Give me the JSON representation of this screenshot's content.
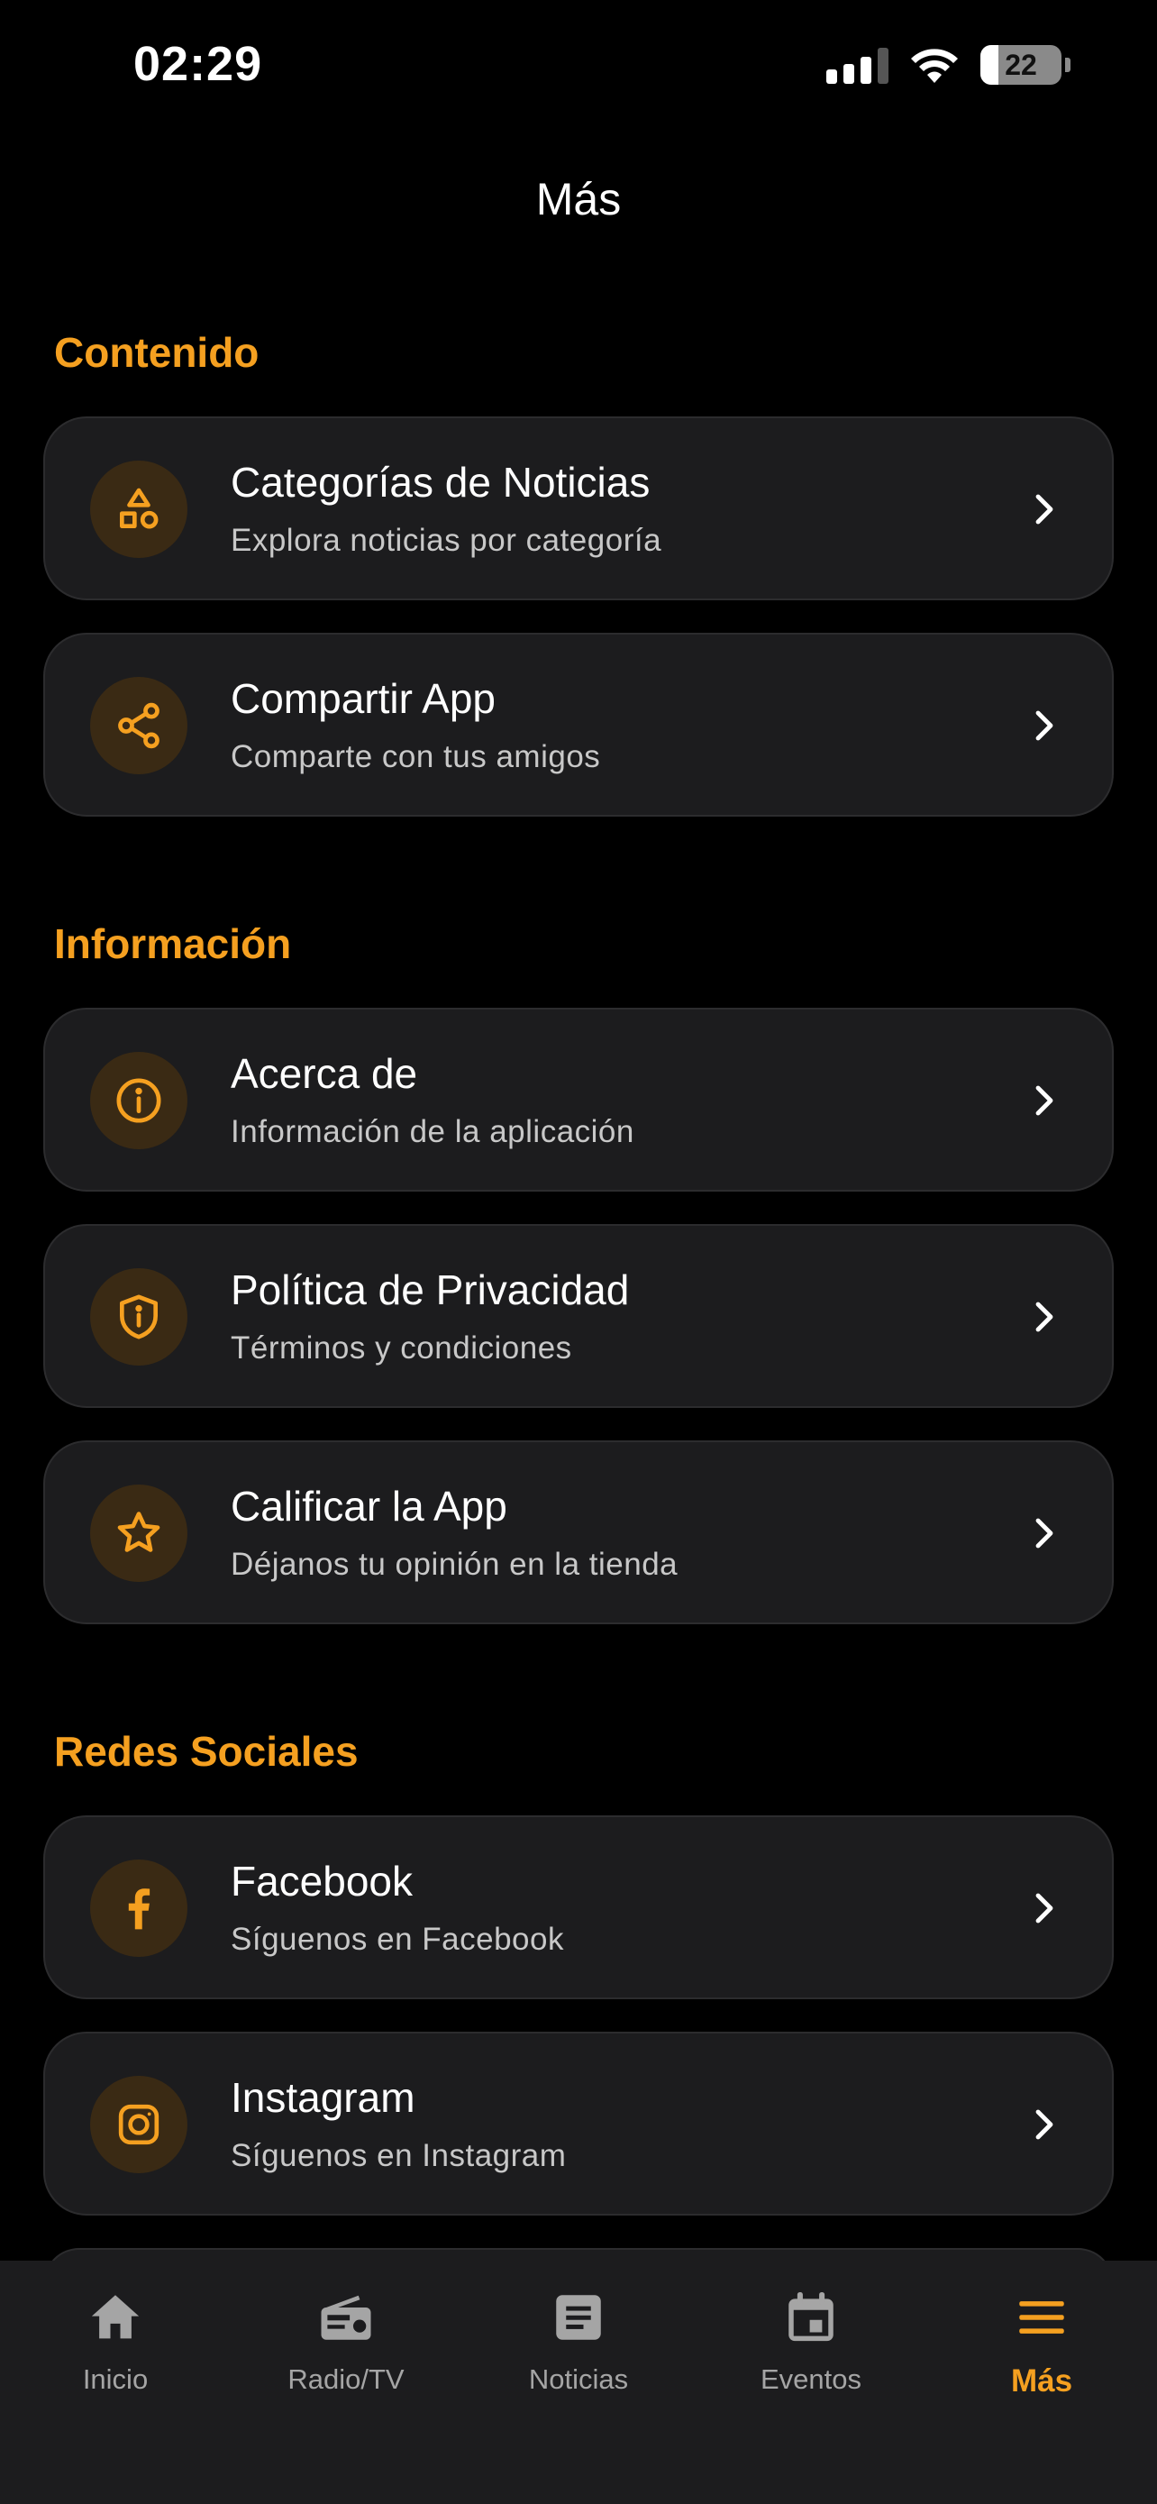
{
  "status_bar": {
    "time": "02:29",
    "battery": "22",
    "battery_level": 0.22
  },
  "header": {
    "title": "Más"
  },
  "colors": {
    "accent": "#f5a020",
    "background": "#000000",
    "card": "#1c1c1e",
    "icon_bg": "#3a2a14",
    "inactive_tab": "#a5a5a5"
  },
  "sections": [
    {
      "title": "Contenido",
      "items": [
        {
          "icon": "shapes-icon",
          "title": "Categorías de Noticias",
          "subtitle": "Explora noticias por categoría"
        },
        {
          "icon": "share-icon",
          "title": "Compartir App",
          "subtitle": "Comparte con tus amigos"
        }
      ]
    },
    {
      "title": "Información",
      "items": [
        {
          "icon": "info-icon",
          "title": "Acerca de",
          "subtitle": "Información de la aplicación"
        },
        {
          "icon": "shield-icon",
          "title": "Política de Privacidad",
          "subtitle": "Términos y condiciones"
        },
        {
          "icon": "star-icon",
          "title": "Calificar la App",
          "subtitle": "Déjanos tu opinión en la tienda"
        }
      ]
    },
    {
      "title": "Redes Sociales",
      "items": [
        {
          "icon": "facebook-icon",
          "title": "Facebook",
          "subtitle": "Síguenos en Facebook"
        },
        {
          "icon": "instagram-icon",
          "title": "Instagram",
          "subtitle": "Síguenos en Instagram"
        }
      ]
    }
  ],
  "tabs": [
    {
      "icon": "home-icon",
      "label": "Inicio"
    },
    {
      "icon": "radio-icon",
      "label": "Radio/TV"
    },
    {
      "icon": "news-icon",
      "label": "Noticias"
    },
    {
      "icon": "calendar-icon",
      "label": "Eventos"
    },
    {
      "icon": "menu-icon",
      "label": "Más",
      "active": true
    }
  ]
}
